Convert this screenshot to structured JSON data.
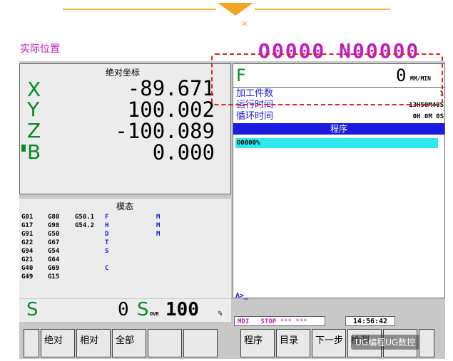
{
  "header": {
    "actual_position": "实际位置",
    "program_number": "O0000 N00000",
    "close": "×"
  },
  "abs_panel": {
    "title": "绝对坐标",
    "axes": [
      {
        "axis": "X",
        "value": "-89.671"
      },
      {
        "axis": "Y",
        "value": "100.002"
      },
      {
        "axis": "Z",
        "value": "-100.089"
      },
      {
        "axis": "B",
        "value": "0.000"
      }
    ]
  },
  "modal": {
    "title": "模态",
    "col1": [
      "G01",
      "G17",
      "G91",
      "G22",
      "G94",
      "G21",
      "G40",
      "G49"
    ],
    "col2": [
      "G80",
      "G98",
      "G50",
      "G67",
      "G54",
      "G64",
      "G69",
      "G15"
    ],
    "col3": [
      "G50.1",
      "G54.2",
      "",
      "",
      "",
      "",
      "",
      ""
    ],
    "col4": [
      "F",
      "H",
      "D",
      "T",
      "S",
      "",
      "C",
      ""
    ],
    "col5": [
      "M",
      "M",
      "M",
      "",
      "",
      "",
      "",
      ""
    ]
  },
  "spindle": {
    "s_label": "S",
    "s_value": "0",
    "sovr_label": "S",
    "sovr_sub": "OVR",
    "sovr_value": "100",
    "pct": "%"
  },
  "right_panel": {
    "feed_label": "F",
    "feed_value": "0",
    "feed_unit": "MM/MIN",
    "rows": [
      {
        "label": "加工件数",
        "value": "1"
      },
      {
        "label": "运行时间",
        "value": "13H50M40S"
      },
      {
        "label": "循环时间",
        "value": "0H 0M 0S"
      }
    ],
    "program_header": "程序",
    "program_line": "O0000%",
    "prompt": "A>_"
  },
  "status": {
    "mode": "MDI",
    "state": "STOP",
    "stars": "*** ***",
    "time": "14:56:42"
  },
  "softkeys_left": [
    "绝对",
    "相对",
    "全部",
    "",
    ""
  ],
  "softkeys_right": [
    "程序",
    "目录",
    "下一步",
    "检测",
    ""
  ],
  "watermark": "UG编程UG数控"
}
